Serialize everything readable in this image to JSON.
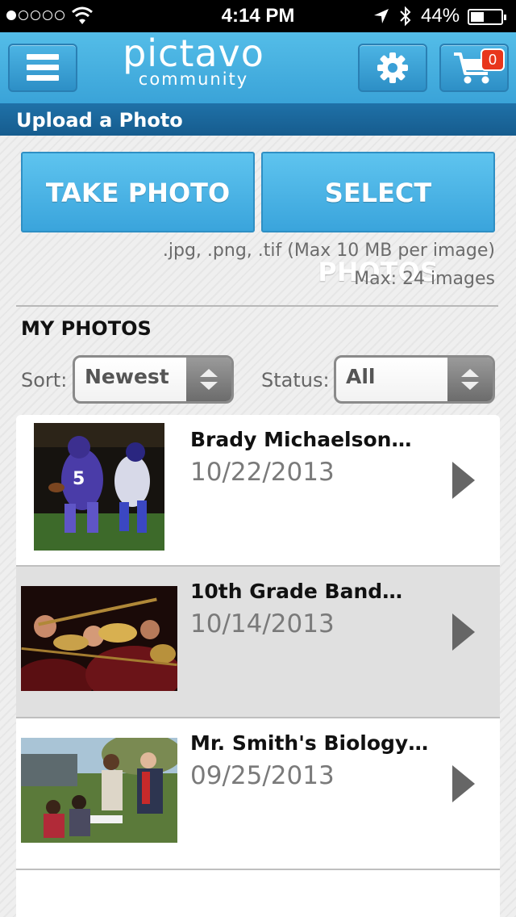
{
  "status_bar": {
    "time": "4:14 PM",
    "battery": "44%",
    "battery_level": 0.44,
    "signal_bars": 1,
    "icons": [
      "signal-dots-icon",
      "wifi-icon",
      "location-arrow-icon",
      "bluetooth-icon",
      "battery-icon"
    ]
  },
  "header": {
    "logo_main": "pictavo",
    "logo_tm": "™",
    "logo_sub": "community",
    "cart_count": "0",
    "icons": [
      "hamburger-menu-icon",
      "gear-icon",
      "shopping-cart-icon"
    ]
  },
  "section": {
    "title": "Upload a Photo"
  },
  "upload": {
    "take_photo": "TAKE PHOTO",
    "select_photos": "SELECT PHOTOS",
    "formats_hint": ".jpg, .png, .tif (Max 10 MB per image)",
    "max_hint": "Max: 24 images"
  },
  "my_photos": {
    "heading": "MY PHOTOS",
    "sort_label": "Sort:",
    "sort_value": "Newest",
    "status_label": "Status:",
    "status_value": "All"
  },
  "photos": [
    {
      "title": "Brady Michaelson…",
      "date": "10/22/2013",
      "thumb": "football-players-photo"
    },
    {
      "title": "10th Grade Band…",
      "date": "10/14/2013",
      "thumb": "marching-band-photo"
    },
    {
      "title": "Mr. Smith's Biology…",
      "date": "09/25/2013",
      "thumb": "students-outdoors-photo"
    }
  ],
  "colors": {
    "header_blue": "#3aa3d8",
    "section_blue": "#1a659c",
    "button_blue": "#4cb4e6",
    "badge_red": "#e8361c"
  }
}
